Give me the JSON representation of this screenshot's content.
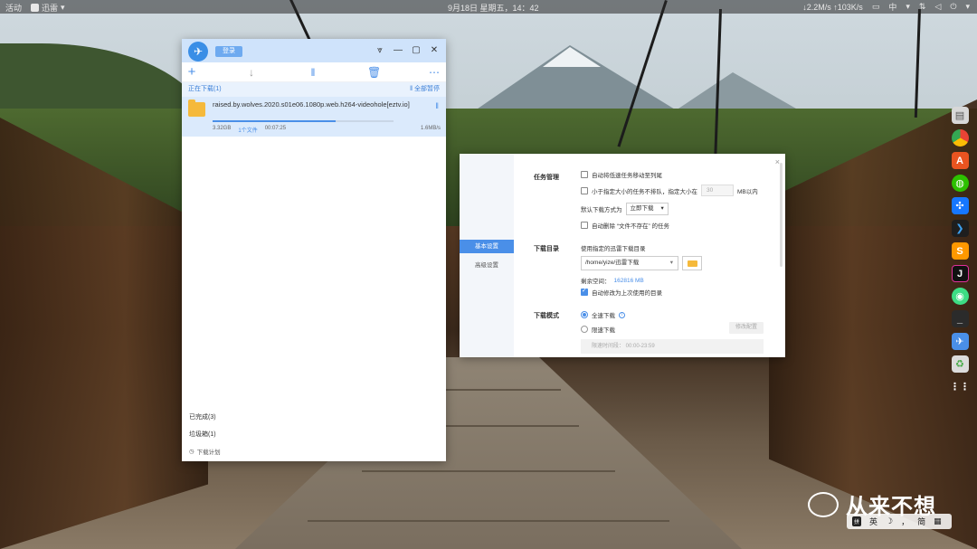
{
  "topbar": {
    "activities": "活动",
    "app_name": "迅雷",
    "datetime": "9月18日 星期五，14：42",
    "net_speed": "↓2.2M/s ↑103K/s",
    "input_method": "中"
  },
  "download_window": {
    "login_label": "登录",
    "section_downloading": "正在下载(1)",
    "pause_all": "全部暂停",
    "item": {
      "filename": "raised.by.wolves.2020.s01e06.1080p.web.h264-videohole[eztv.io]",
      "size": "3.32GB",
      "files": "1个文件",
      "eta": "00:07:25",
      "speed": "1.6MB/s",
      "progress": 0.68
    },
    "completed": "已完成(3)",
    "trash": "垃圾箱(1)",
    "schedule": "下载计划"
  },
  "settings": {
    "nav": [
      "基本设置",
      "高级设置"
    ],
    "task_mgmt": {
      "title": "任务管理",
      "auto_move_slow": "自动将低速任务移动至列尾",
      "small_task_prefix": "小于指定大小的任务不排队，指定大小在",
      "small_task_value": "30",
      "small_task_suffix": "MB以内",
      "default_mode_label": "默认下载方式为",
      "default_mode_value": "立即下载",
      "auto_delete_missing": "自动删除 “文件不存在” 的任务"
    },
    "download_dir": {
      "title": "下载目录",
      "use_default": "使用指定的迅雷下载目录",
      "path": "/home/yize/迅雷下载",
      "free_space_label": "剩余空间：",
      "free_space_value": "162816 MB",
      "auto_change": "自动修改为上次使用的目录"
    },
    "download_mode": {
      "title": "下载模式",
      "full_speed": "全速下载",
      "limited": "限速下载",
      "modify_config": "修改配置",
      "limit_time": "限速时间段：  00:00-23:59"
    }
  },
  "watermark": {
    "text": "从来不想",
    "ime_badge": "拼",
    "ime_lang": "英",
    "ime_moon": "☽",
    "ime_dot": "，",
    "ime_mode": "简",
    "ime_grid": "▦"
  },
  "colors": {
    "accent": "#4a8fe8",
    "title_bar": "#cfe3fb",
    "folder": "#f5b93b"
  }
}
